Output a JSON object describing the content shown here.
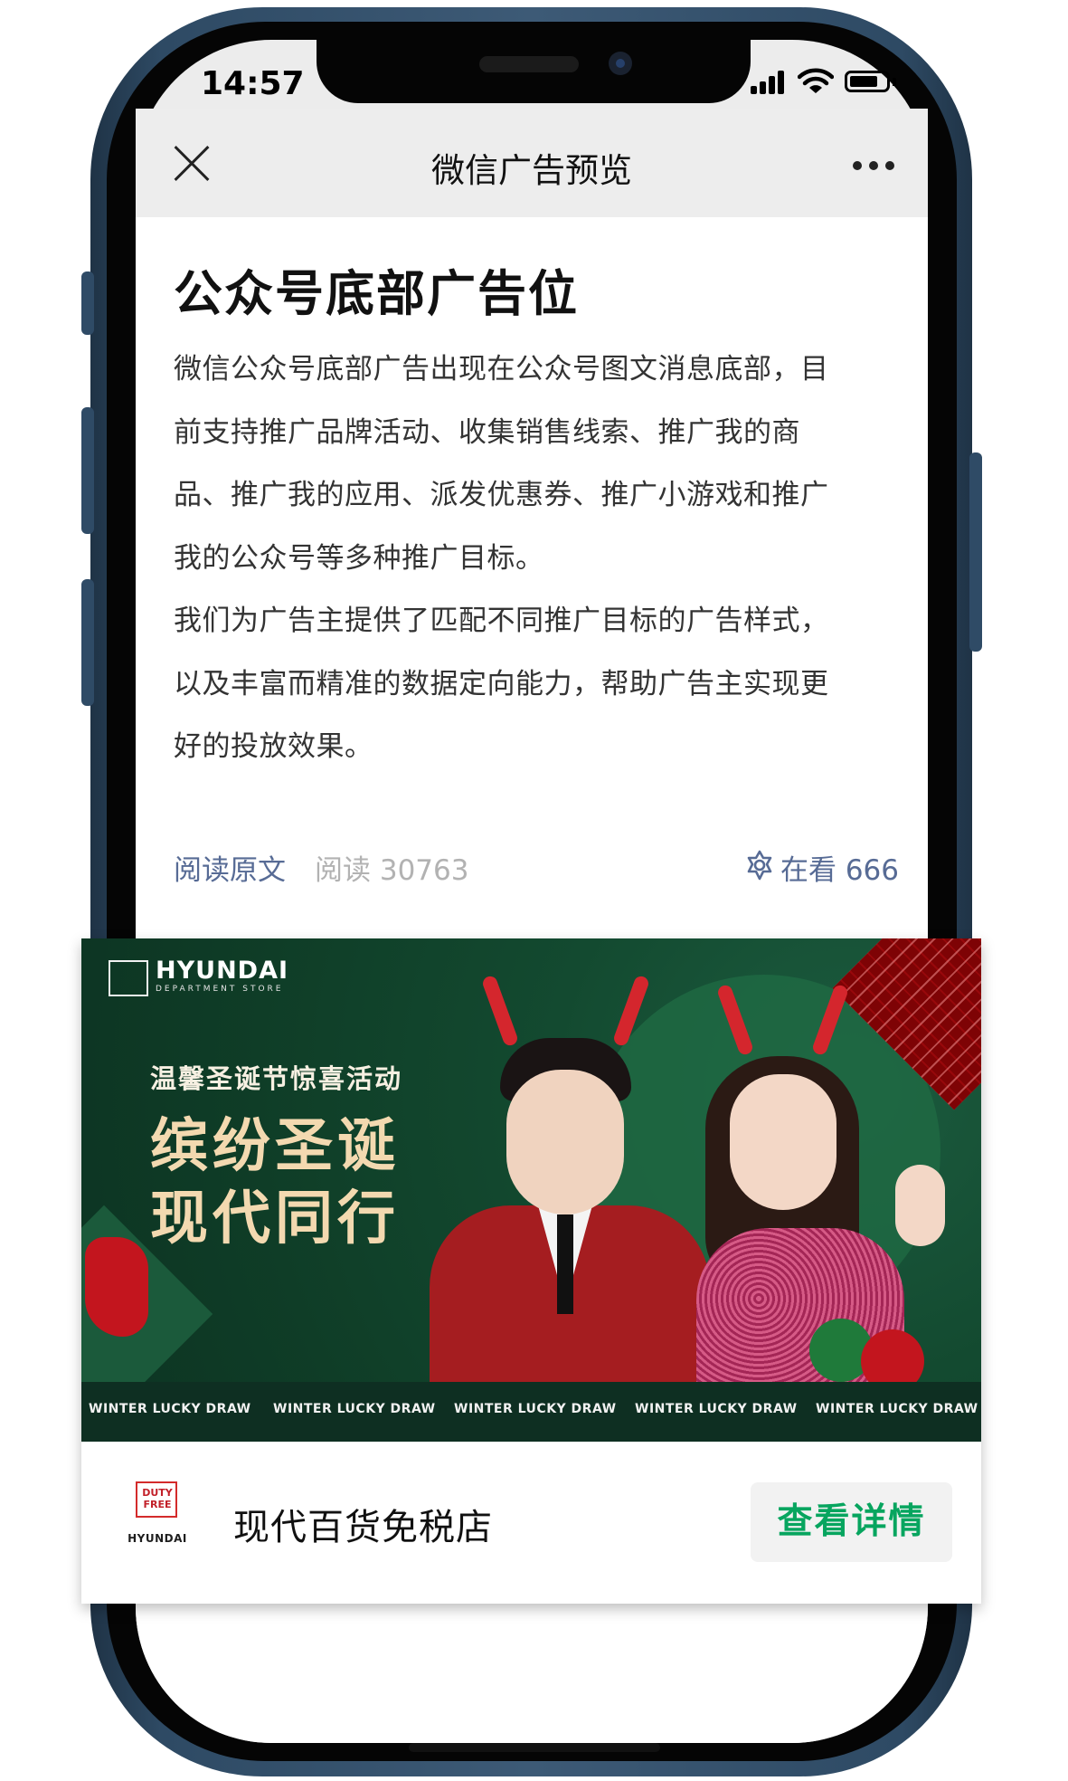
{
  "status_bar": {
    "time": "14:57"
  },
  "nav": {
    "title": "微信广告预览"
  },
  "article": {
    "title": "公众号底部广告位",
    "body_lines": [
      "微信公众号底部广告出现在公众号图文消息底部，目",
      "前支持推广品牌活动、收集销售线索、推广我的商",
      "品、推广我的应用、派发优惠券、推广小游戏和推广",
      "我的公众号等多种推广目标。",
      "我们为广告主提供了匹配不同推广目标的广告样式，",
      "以及丰富而精准的数据定向能力，帮助广告主实现更",
      "好的投放效果。"
    ],
    "read_original": "阅读原文",
    "read_count": "阅读 30763",
    "looking": "在看 666"
  },
  "ad": {
    "banner": {
      "brand_name": "HYUNDAI",
      "brand_sub": "DEPARTMENT STORE",
      "promo_sub": "温馨圣诞节惊喜活动",
      "promo_line1": "缤纷圣诞",
      "promo_line2": "现代同行",
      "strip_items": [
        "WINTER LUCKY DRAW",
        "WINTER LUCKY DRAW",
        "WINTER LUCKY DRAW",
        "WINTER LUCKY DRAW",
        "WINTER LUCKY DRAW"
      ]
    },
    "advertiser": {
      "logo_line1": "DUTY",
      "logo_line2": "FREE",
      "logo_brand": "HYUNDAI",
      "name": "现代百货免税店"
    },
    "cta": "查看详情"
  },
  "colors": {
    "link_blue": "#576b95",
    "count_gray": "#b2b2b2",
    "cta_green": "#07a55f",
    "banner_green": "#134a30",
    "accent_red": "#c3151e"
  },
  "icons": [
    "close-icon",
    "more-icon",
    "looking-icon",
    "signal-icon",
    "wifi-icon",
    "battery-icon"
  ]
}
